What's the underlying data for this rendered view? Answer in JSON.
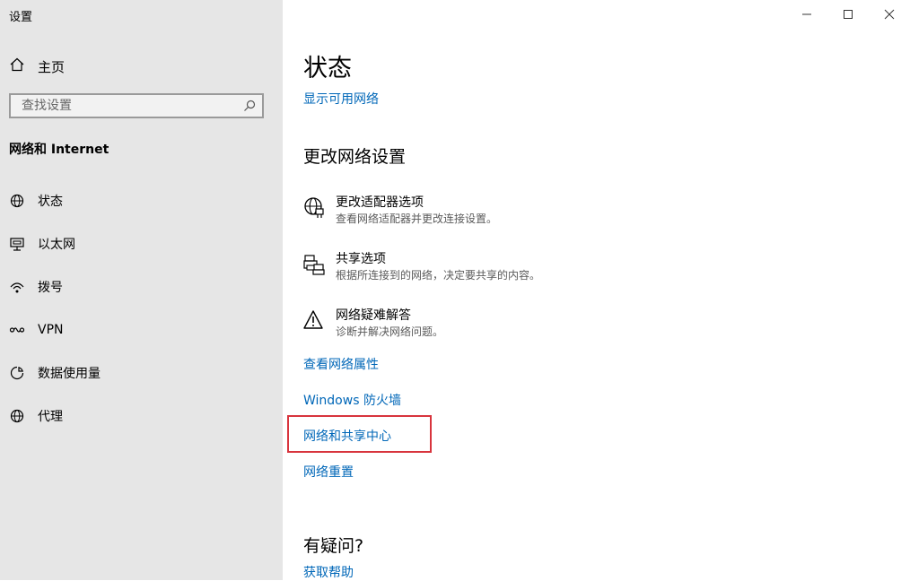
{
  "window": {
    "title": "设置",
    "controls": {
      "minimize_icon": "minimize-icon",
      "maximize_icon": "maximize-icon",
      "close_icon": "close-icon"
    }
  },
  "sidebar": {
    "home_label": "主页",
    "search": {
      "placeholder": "查找设置",
      "icon": "search-icon"
    },
    "section_title": "网络和 Internet",
    "items": [
      {
        "label": "状态",
        "icon": "globe-status-icon"
      },
      {
        "label": "以太网",
        "icon": "ethernet-icon"
      },
      {
        "label": "拨号",
        "icon": "dialup-icon"
      },
      {
        "label": "VPN",
        "icon": "vpn-icon"
      },
      {
        "label": "数据使用量",
        "icon": "data-usage-icon"
      },
      {
        "label": "代理",
        "icon": "globe-icon"
      }
    ]
  },
  "main": {
    "page_title": "状态",
    "show_networks_link": "显示可用网络",
    "change_settings_heading": "更改网络设置",
    "options": [
      {
        "title": "更改适配器选项",
        "description": "查看网络适配器并更改连接设置。",
        "icon": "adapter-icon"
      },
      {
        "title": "共享选项",
        "description": "根据所连接到的网络，决定要共享的内容。",
        "icon": "printer-share-icon"
      },
      {
        "title": "网络疑难解答",
        "description": "诊断并解决网络问题。",
        "icon": "warning-icon"
      }
    ],
    "links": [
      "查看网络属性",
      "Windows 防火墙",
      "网络和共享中心",
      "网络重置"
    ],
    "help_heading": "有疑问?",
    "help_link": "获取帮助"
  },
  "colors": {
    "link": "#0067b8",
    "sidebar_bg": "#e6e6e6",
    "highlight_box": "#d8343d"
  }
}
